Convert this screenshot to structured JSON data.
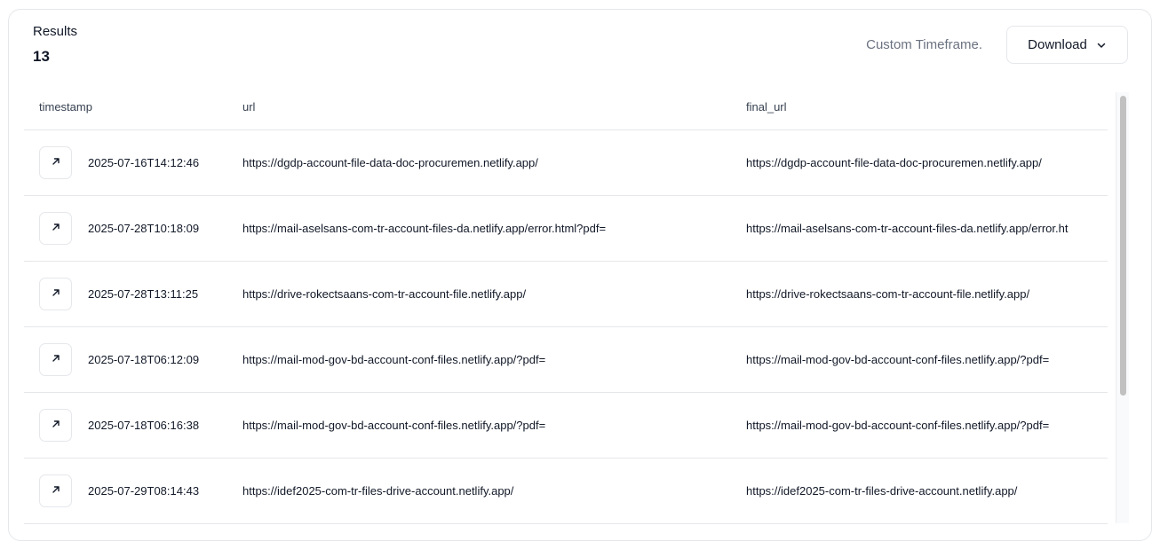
{
  "header": {
    "results_label": "Results",
    "results_count": "13",
    "timeframe": "Custom Timeframe.",
    "download_label": "Download"
  },
  "table": {
    "columns": [
      "timestamp",
      "url",
      "final_url"
    ],
    "rows": [
      {
        "timestamp": "2025-07-16T14:12:46",
        "url": "https://dgdp-account-file-data-doc-procuremen.netlify.app/",
        "final_url": "https://dgdp-account-file-data-doc-procuremen.netlify.app/"
      },
      {
        "timestamp": "2025-07-28T10:18:09",
        "url": "https://mail-aselsans-com-tr-account-files-da.netlify.app/error.html?pdf=",
        "final_url": "https://mail-aselsans-com-tr-account-files-da.netlify.app/error.ht"
      },
      {
        "timestamp": "2025-07-28T13:11:25",
        "url": "https://drive-rokectsaans-com-tr-account-file.netlify.app/",
        "final_url": "https://drive-rokectsaans-com-tr-account-file.netlify.app/"
      },
      {
        "timestamp": "2025-07-18T06:12:09",
        "url": "https://mail-mod-gov-bd-account-conf-files.netlify.app/?pdf=",
        "final_url": "https://mail-mod-gov-bd-account-conf-files.netlify.app/?pdf="
      },
      {
        "timestamp": "2025-07-18T06:16:38",
        "url": "https://mail-mod-gov-bd-account-conf-files.netlify.app/?pdf=",
        "final_url": "https://mail-mod-gov-bd-account-conf-files.netlify.app/?pdf="
      },
      {
        "timestamp": "2025-07-29T08:14:43",
        "url": "https://idef2025-com-tr-files-drive-account.netlify.app/",
        "final_url": "https://idef2025-com-tr-files-drive-account.netlify.app/"
      }
    ]
  },
  "icons": {
    "row_action": "arrow-up-right-icon",
    "download_caret": "chevron-down-icon"
  },
  "colors": {
    "border": "#e5e7eb",
    "muted_text": "#6b7280",
    "text": "#111827"
  }
}
